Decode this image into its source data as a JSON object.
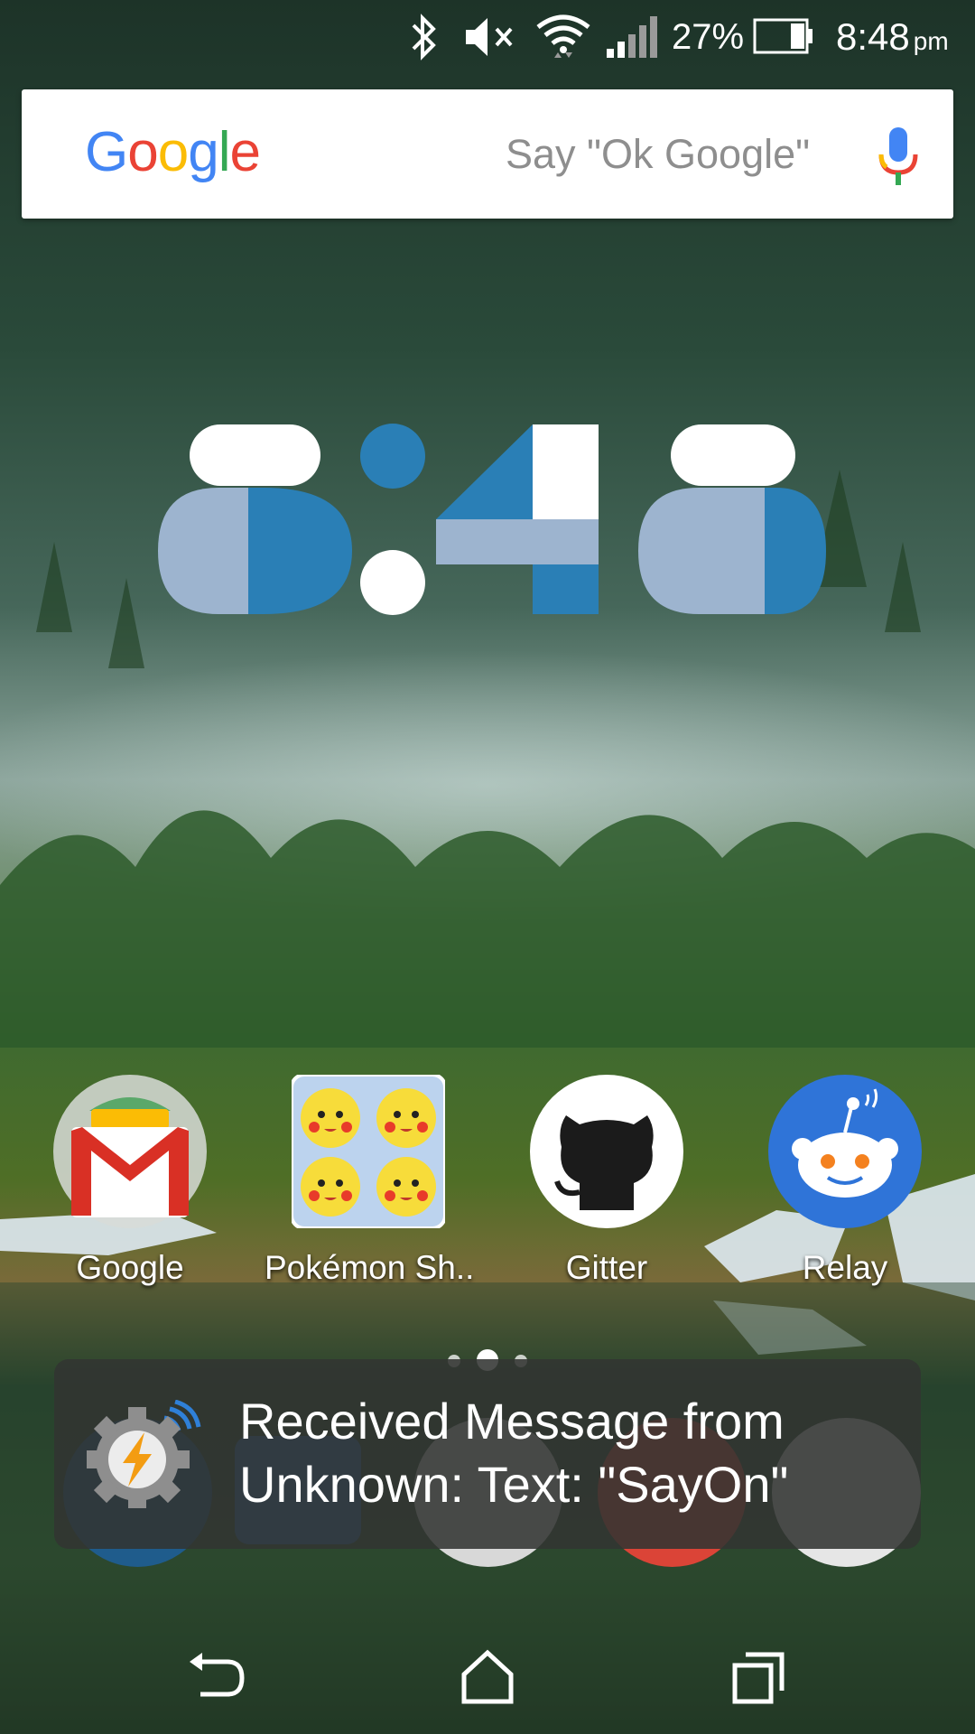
{
  "status_bar": {
    "icons": [
      "bluetooth-icon",
      "volume-muted-icon",
      "wifi-icon",
      "cell-signal-icon",
      "battery-icon"
    ],
    "battery_percent": "27%",
    "time": "8:48",
    "ampm": "pm"
  },
  "search_bar": {
    "logo_letters": [
      "G",
      "o",
      "o",
      "g",
      "l",
      "e"
    ],
    "logo_colors": [
      "#4285F4",
      "#EA4335",
      "#FBBC05",
      "#4285F4",
      "#34A853",
      "#EA4335"
    ],
    "placeholder": "Say \"Ok Google\"",
    "mic_icon": "mic-icon"
  },
  "clock_widget": {
    "time": "8:48",
    "colors": {
      "light": "#9db4cf",
      "blue": "#2a7fb6",
      "white": "#ffffff"
    }
  },
  "apps": [
    {
      "label": "Google",
      "icon": "gmail-icon"
    },
    {
      "label": "Pokémon Sh..",
      "icon": "pokemon-shuffle-icon"
    },
    {
      "label": "Gitter",
      "icon": "github-octocat-icon"
    },
    {
      "label": "Relay",
      "icon": "reddit-relay-icon"
    }
  ],
  "page_indicator": {
    "pages": 3,
    "current": 2
  },
  "toast": {
    "icon": "tasker-icon",
    "message": "Received Message from Unknown: Text: \"SayOn\""
  },
  "nav_bar": {
    "buttons": [
      "back-icon",
      "home-icon",
      "recents-icon"
    ]
  }
}
